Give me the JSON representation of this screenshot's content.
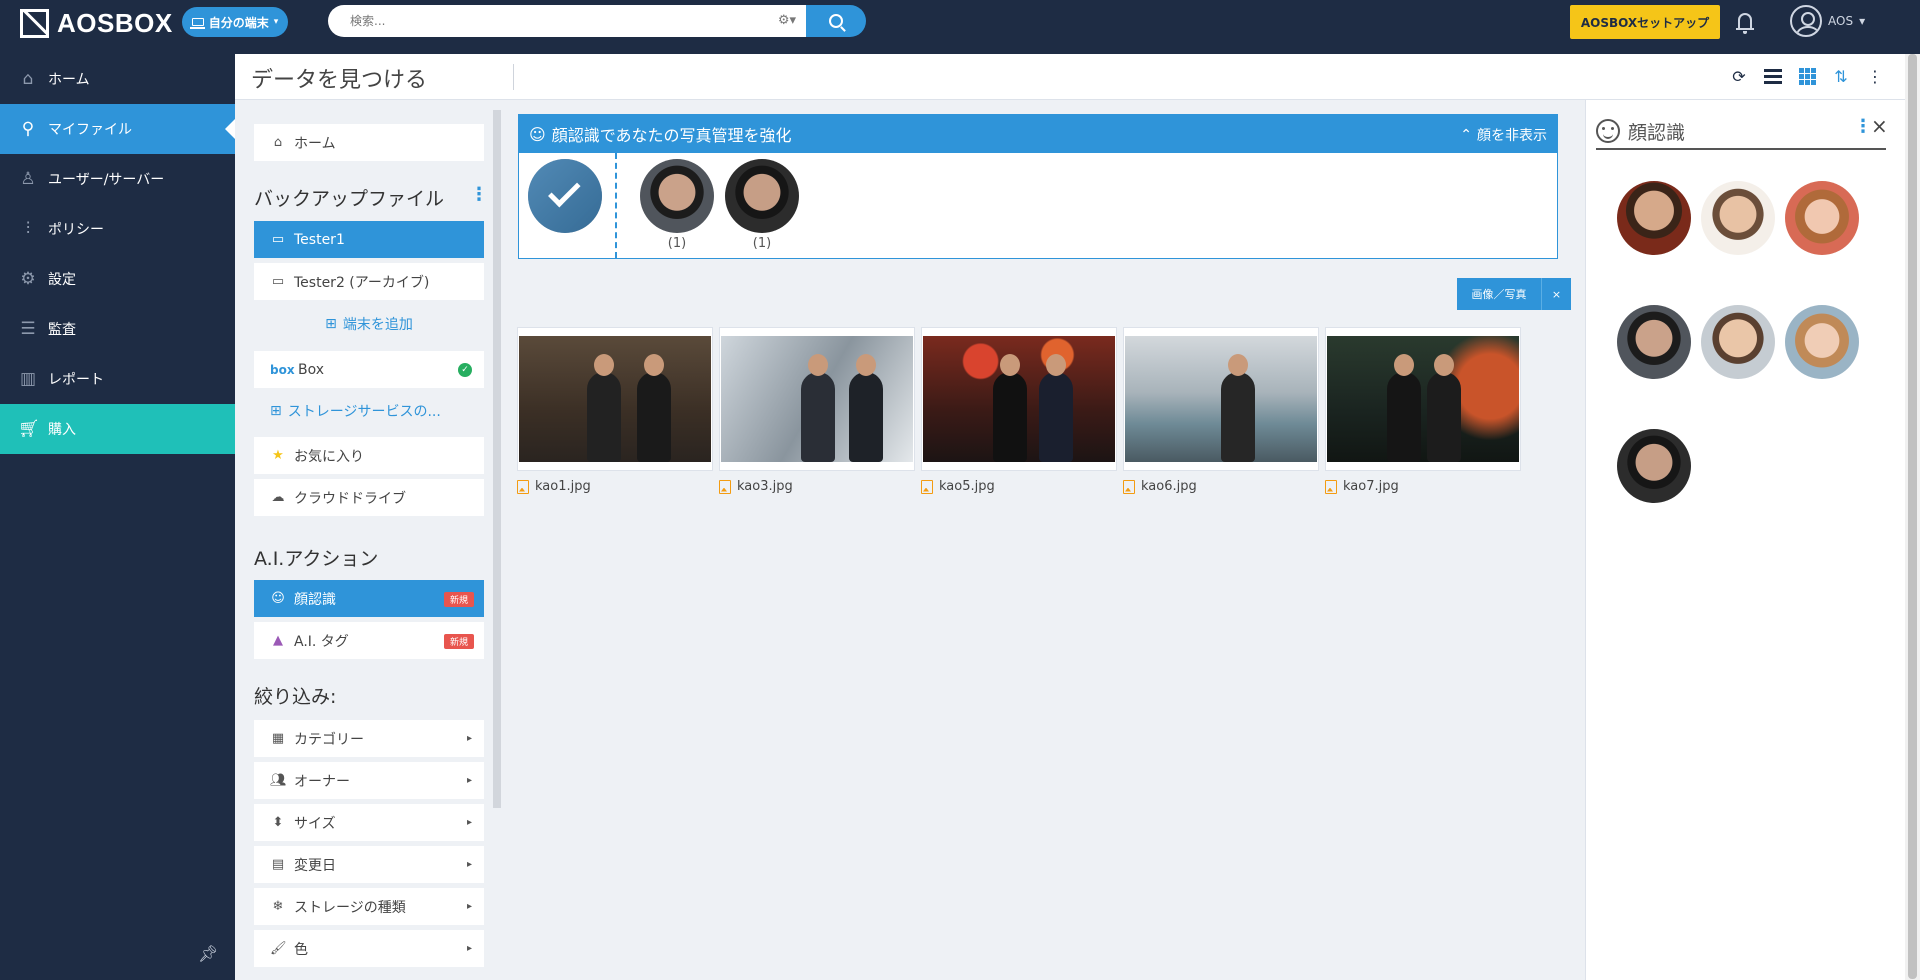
{
  "app": {
    "logo_text": "AOSBOX",
    "device_selector": "自分の端末",
    "search_placeholder": "検索...",
    "setup_button": "AOSBOXセットアップ",
    "user_name": "AOS"
  },
  "nav": {
    "items": [
      {
        "label": "ホーム",
        "icon": "home-icon"
      },
      {
        "label": "マイファイル",
        "icon": "search-icon"
      },
      {
        "label": "ユーザー/サーバー",
        "icon": "users-icon"
      },
      {
        "label": "ポリシー",
        "icon": "sliders-icon"
      },
      {
        "label": "設定",
        "icon": "gear-icon"
      },
      {
        "label": "監査",
        "icon": "list-icon"
      },
      {
        "label": "レポート",
        "icon": "bar-chart-icon"
      },
      {
        "label": "購入",
        "icon": "cart-icon"
      }
    ],
    "active_index": 1
  },
  "header": {
    "title": "データを見つける"
  },
  "side": {
    "home": "ホーム",
    "backup_heading": "バックアップファイル",
    "devices": [
      "Tester1",
      "Tester2 (アーカイブ)"
    ],
    "add_device": "端末を追加",
    "storage_box_logo": "box",
    "storage_box": "Box",
    "add_storage": "ストレージサービスの...",
    "favorites": "お気に入り",
    "cloud_drive": "クラウドドライブ",
    "ai_heading": "A.I.アクション",
    "ai_items": [
      {
        "label": "顔認識",
        "badge": "新規"
      },
      {
        "label": "A.I. タグ",
        "badge": "新規"
      }
    ],
    "filter_heading": "絞り込み:",
    "filters": [
      "カテゴリー",
      "オーナー",
      "サイズ",
      "変更日",
      "ストレージの種類",
      "色"
    ]
  },
  "face_banner": {
    "title": "顔認識であなたの写真管理を強化",
    "hide_label": "顔を非表示",
    "counts": [
      "(1)",
      "(1)"
    ]
  },
  "filter_tag": {
    "label": "画像／写真",
    "close": "×"
  },
  "files": [
    "kao1.jpg",
    "kao3.jpg",
    "kao5.jpg",
    "kao6.jpg",
    "kao7.jpg"
  ],
  "right_panel": {
    "title": "顔認識",
    "close": "×"
  },
  "colors": {
    "navy": "#1e2c44",
    "blue": "#2f94d9",
    "teal": "#1fc0b8",
    "yellow": "#f5c518",
    "badge_red": "#e8554e"
  }
}
